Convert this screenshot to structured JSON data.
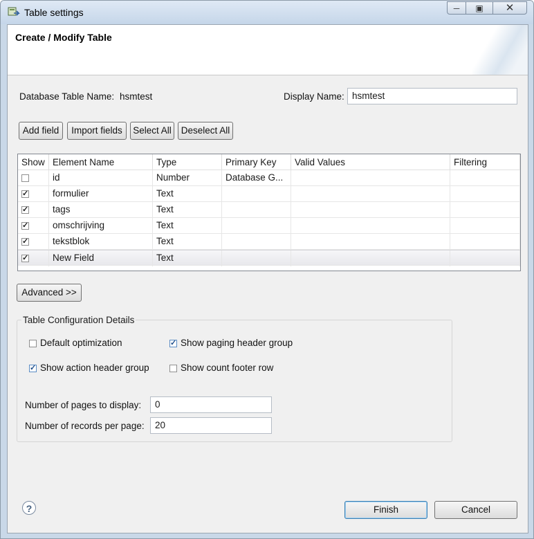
{
  "window": {
    "title": "Table settings",
    "minimize_glyph": "─",
    "maximize_glyph": "▣",
    "close_glyph": "✕"
  },
  "header": {
    "title": "Create / Modify Table"
  },
  "form": {
    "db_table_label": "Database Table Name:",
    "db_table_value": "hsmtest",
    "display_name_label": "Display Name:",
    "display_name_value": "hsmtest"
  },
  "toolbar": {
    "add_field": "Add field",
    "import_fields": "Import fields",
    "select_all": "Select All",
    "deselect_all": "Deselect All"
  },
  "table": {
    "columns": [
      "Show",
      "Element Name",
      "Type",
      "Primary Key",
      "Valid Values",
      "Filtering"
    ],
    "rows": [
      {
        "show": false,
        "name": "id",
        "type": "Number",
        "primary_key": "Database G...",
        "valid_values": "",
        "filtering": ""
      },
      {
        "show": true,
        "name": "formulier",
        "type": "Text",
        "primary_key": "",
        "valid_values": "",
        "filtering": ""
      },
      {
        "show": true,
        "name": "tags",
        "type": "Text",
        "primary_key": "",
        "valid_values": "",
        "filtering": ""
      },
      {
        "show": true,
        "name": "omschrijving",
        "type": "Text",
        "primary_key": "",
        "valid_values": "",
        "filtering": ""
      },
      {
        "show": true,
        "name": "tekstblok",
        "type": "Text",
        "primary_key": "",
        "valid_values": "",
        "filtering": ""
      },
      {
        "show": true,
        "name": "New Field",
        "type": "Text",
        "primary_key": "",
        "valid_values": "",
        "filtering": ""
      }
    ],
    "selected_row_index": 5
  },
  "advanced_button": "Advanced >>",
  "config": {
    "group_title": "Table Configuration Details",
    "default_optimization": {
      "label": "Default optimization",
      "checked": false
    },
    "show_paging_header_group": {
      "label": "Show paging header group",
      "checked": true
    },
    "show_action_header_group": {
      "label": "Show action header group",
      "checked": true
    },
    "show_count_footer_row": {
      "label": "Show count footer row",
      "checked": false
    },
    "pages_label": "Number of pages to display:",
    "pages_value": "0",
    "records_label": "Number of records per page:",
    "records_value": "20"
  },
  "footer": {
    "help_glyph": "?",
    "finish": "Finish",
    "cancel": "Cancel"
  },
  "colors": {
    "accent": "#3c7fb1",
    "window_frame": "#c9d8e8"
  }
}
